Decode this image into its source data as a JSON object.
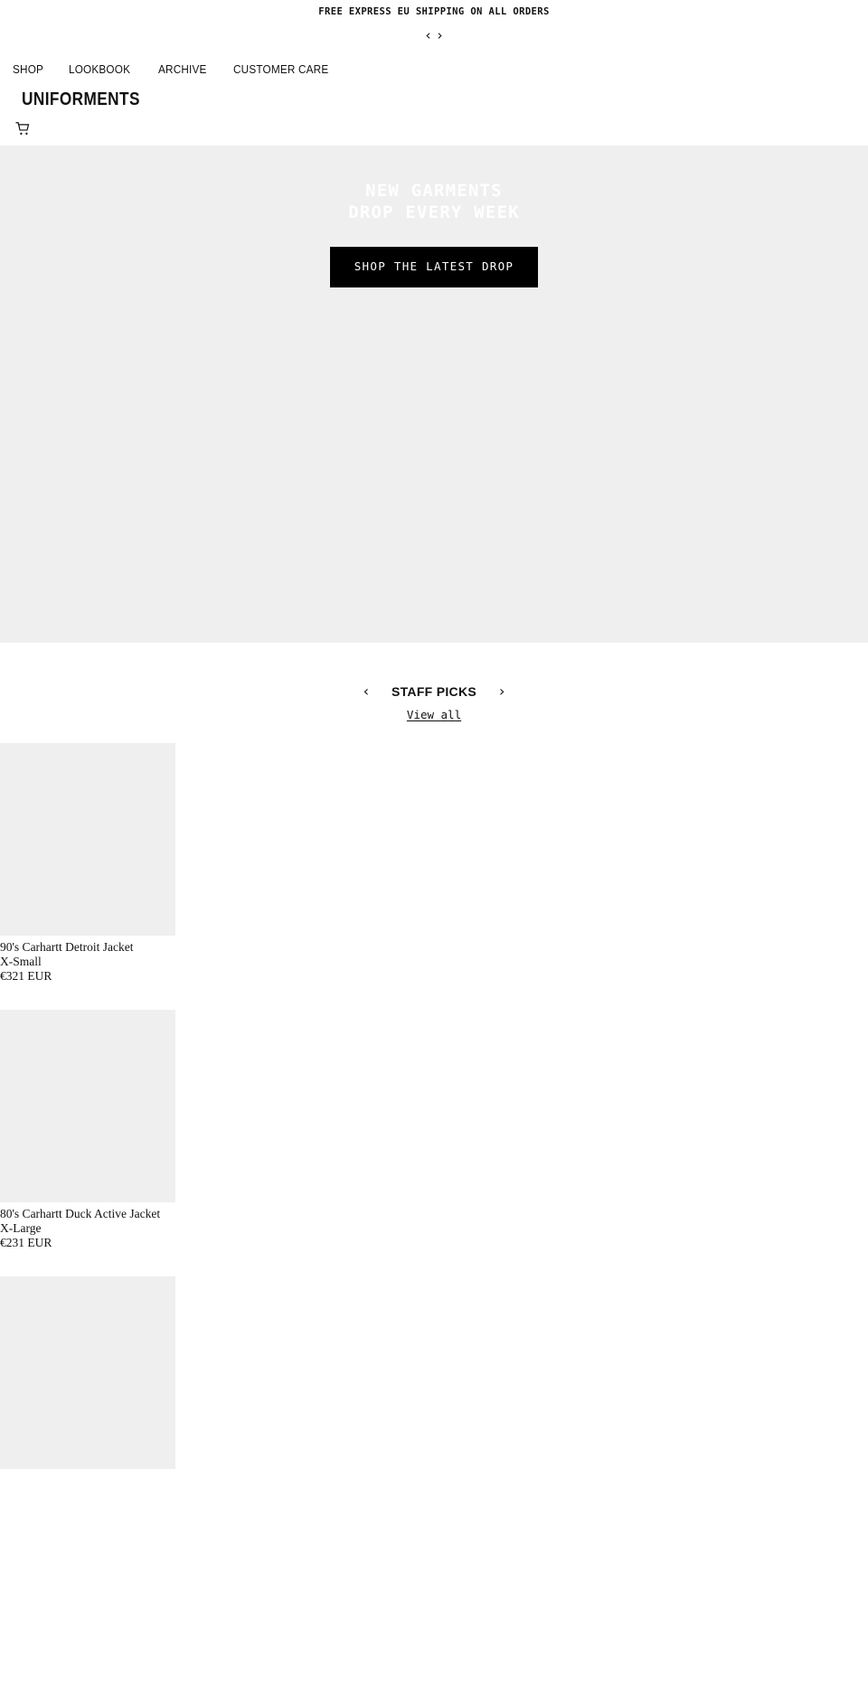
{
  "announcement": {
    "text": "FREE EXPRESS EU SHIPPING ON ALL ORDERS",
    "prev_arrow": "‹",
    "next_arrow": "›"
  },
  "header": {
    "logo": "UNIFORMENTS",
    "nav": [
      {
        "label": "SHOP"
      },
      {
        "label": "LOOKBOOK"
      },
      {
        "label": "ARCHIVE"
      },
      {
        "label": "CUSTOMER CARE"
      }
    ],
    "cart_icon": "shopping-cart-icon"
  },
  "hero": {
    "heading_line_1": "NEW GARMENTS",
    "heading_line_2": "DROP EVERY WEEK",
    "cta_label": "SHOP THE LATEST DROP",
    "background_color": "#efefef",
    "heading_color": "#ffffff",
    "cta_background": "#000000"
  },
  "collection": {
    "title": "STAFF PICKS",
    "prev_arrow": "‹",
    "next_arrow": "›",
    "view_all": "View all",
    "products": [
      {
        "title": "90's Carhartt Detroit Jacket",
        "size": "X-Small",
        "price": "€321 EUR"
      },
      {
        "title": "80's Carhartt Duck Active Jacket",
        "size": "X-Large",
        "price": "€231 EUR"
      },
      {
        "title": "",
        "size": "",
        "price": ""
      }
    ]
  }
}
